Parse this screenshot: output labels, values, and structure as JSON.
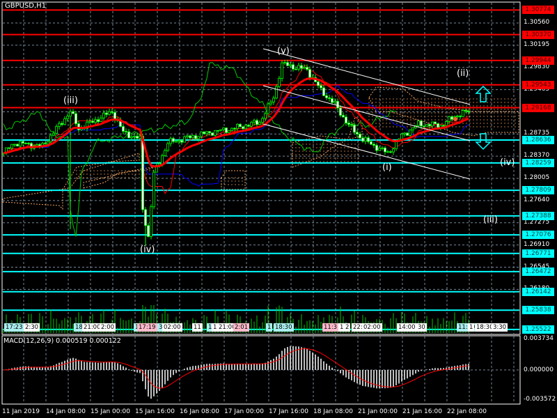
{
  "window": {
    "title": "GBPUSD,H1"
  },
  "indicator": {
    "macd_label": "MACD(12,26,9) 0.000519 0.000122",
    "macd_max": "0.003734",
    "macd_zero": "0.000000",
    "macd_min": "-0.003572"
  },
  "price_axis": [
    "1.30560",
    "1.30195",
    "1.29830",
    "1.29465",
    "1.29100",
    "1.28735",
    "1.28370",
    "1.28005",
    "1.27640",
    "1.27275",
    "1.26910",
    "1.26545",
    "1.26180"
  ],
  "resistance_levels": [
    "1.30774",
    "1.30370",
    "1.29944",
    "1.29543",
    "1.29168"
  ],
  "support_levels": [
    "1.28636",
    "1.28259",
    "1.27809",
    "1.27388",
    "1.27076",
    "1.26771",
    "1.26472",
    "1.26142",
    "1.25838",
    "1.25522"
  ],
  "date_axis": [
    "11 Jan 2019",
    "14 Jan 08:00",
    "15 Jan 00:00",
    "15 Jan 16:00",
    "16 Jan 08:00",
    "17 Jan 00:00",
    "17 Jan 16:00",
    "18 Jan 08:00",
    "21 Jan 00:00",
    "21 Jan 16:00",
    "22 Jan 08:00"
  ],
  "time_labels": [
    {
      "t": "17:23",
      "c": "cy"
    },
    {
      "t": "2:30",
      "c": ""
    },
    {
      "t": "18",
      "c": "cy"
    },
    {
      "t": "21:00",
      "c": ""
    },
    {
      "t": "2:00",
      "c": ""
    },
    {
      "t": "1",
      "c": "cy"
    },
    {
      "t": "17:19",
      "c": "pk"
    },
    {
      "t": "3",
      "c": "cy"
    },
    {
      "t": "02:00",
      "c": ""
    },
    {
      "t": "11",
      "c": ""
    },
    {
      "t": "1",
      "c": "cy"
    },
    {
      "t": "18",
      "c": ""
    },
    {
      "t": "21:00",
      "c": ""
    },
    {
      "t": "2:01",
      "c": "pk"
    },
    {
      "t": "1",
      "c": "cy"
    },
    {
      "t": "18:30",
      "c": "cy"
    },
    {
      "t": "11:3",
      "c": "pk"
    },
    {
      "t": "17",
      "c": ""
    },
    {
      "t": "2",
      "c": ""
    },
    {
      "t": "22:",
      "c": ""
    },
    {
      "t": "02:00",
      "c": ""
    },
    {
      "t": "14:00",
      "c": ""
    },
    {
      "t": "30",
      "c": ""
    },
    {
      "t": "11:30",
      "c": "cy"
    },
    {
      "t": "1",
      "c": ""
    },
    {
      "t": "18:30",
      "c": ""
    },
    {
      "t": "3:30",
      "c": ""
    }
  ],
  "waves": {
    "v": "(v)",
    "iii_top": "(iii)",
    "iv_low": "(iv)",
    "i": "(i)",
    "ii": "(ii)",
    "iv_right": "(iv)",
    "iii_right": "(iii)"
  },
  "colors": {
    "resistance": "#ff0000",
    "support": "#00ffff",
    "candle": "#00ff00",
    "ma": "#ff0000",
    "cloud": "#f4a460",
    "kijun": "#0000ff"
  },
  "chart_data": {
    "type": "line",
    "symbol": "GBPUSD",
    "timeframe": "H1",
    "waypoints_bar": [
      0,
      4,
      14,
      24,
      27,
      39,
      43,
      49,
      50,
      52,
      54,
      59,
      74,
      82,
      92,
      97,
      100,
      109,
      114,
      119,
      124,
      129,
      138,
      143,
      149,
      157,
      163,
      167
    ],
    "waypoints_price": [
      1.28418,
      1.2859,
      1.28533,
      1.29105,
      1.28819,
      1.29105,
      1.28762,
      1.28647,
      1.27502,
      1.27043,
      1.28074,
      1.2859,
      1.28762,
      1.28819,
      1.28933,
      1.29334,
      1.29884,
      1.29793,
      1.29449,
      1.2922,
      1.28876,
      1.28647,
      1.28418,
      1.28704,
      1.28899,
      1.28876,
      1.29048,
      1.29105
    ],
    "ylim": [
      1.2552,
      1.3092
    ]
  }
}
